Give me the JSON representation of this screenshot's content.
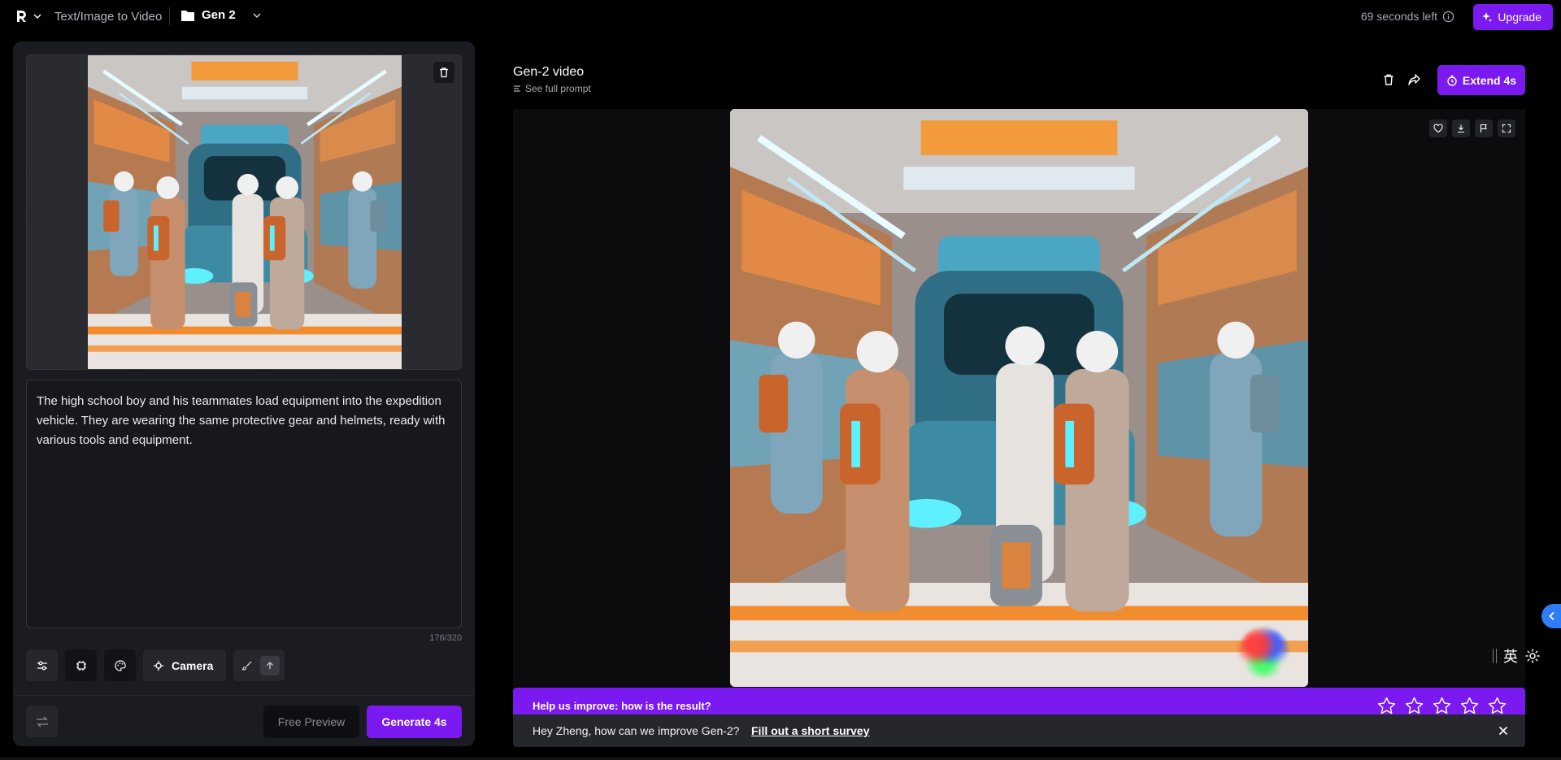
{
  "topbar": {
    "logo_icon": "runway-logo-icon",
    "breadcrumb": "Text/Image to Video",
    "folder_name": "Gen 2",
    "time_left": "69 seconds left",
    "upgrade_label": "Upgrade",
    "accent_color": "#7b1af0"
  },
  "left_panel": {
    "prompt_text": "The high school boy and his teammates load equipment into the expedition vehicle. They are wearing the same protective gear and helmets, ready with various tools and equipment.",
    "char_count": "176/320",
    "tools": {
      "camera_label": "Camera"
    },
    "free_preview_label": "Free Preview",
    "generate_label": "Generate 4s"
  },
  "result": {
    "title": "Gen-2 video",
    "see_prompt_label": "See full prompt",
    "extend_label": "Extend 4s"
  },
  "feedback": {
    "question": "Help us improve: how is the result?",
    "star_count": 5
  },
  "survey": {
    "message": "Hey Zheng, how can we improve Gen-2?",
    "link_label": "Fill out a short survey"
  },
  "ime": {
    "mode_label": "英"
  }
}
